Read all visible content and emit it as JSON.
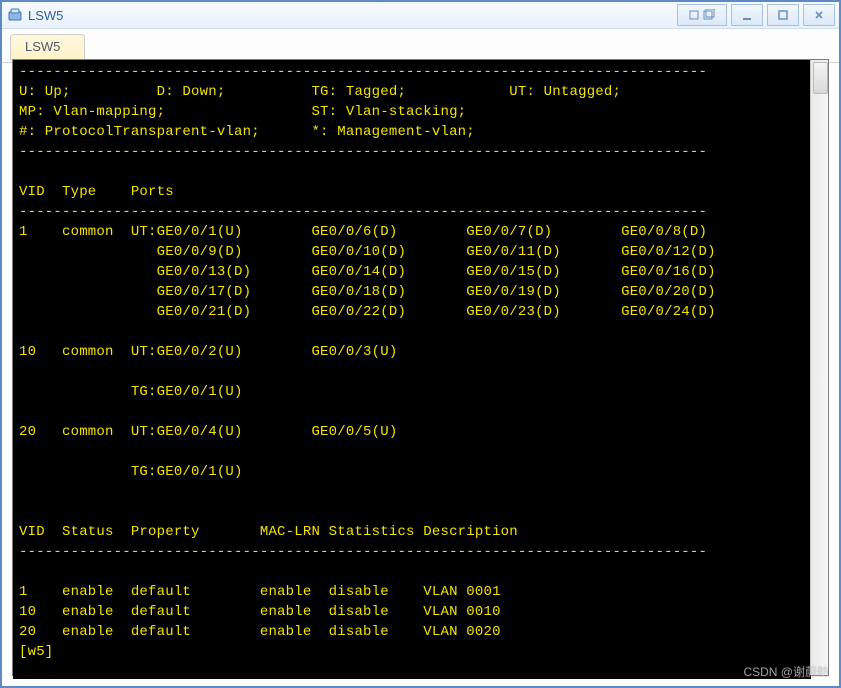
{
  "window": {
    "title": "LSW5"
  },
  "tabs": [
    {
      "label": "LSW5",
      "active": true
    }
  ],
  "legend": {
    "u": "U: Up;",
    "d": "D: Down;",
    "tg": "TG: Tagged;",
    "ut": "UT: Untagged;",
    "mp": "MP: Vlan-mapping;",
    "st": "ST: Vlan-stacking;",
    "hash": "#: ProtocolTransparent-vlan;",
    "star": "*: Management-vlan;"
  },
  "header1": {
    "vid": "VID",
    "type": "Type",
    "ports": "Ports"
  },
  "vlan_ports": [
    {
      "vid": "1",
      "type": "common",
      "tag": "UT:",
      "ports": [
        [
          "GE0/0/1(U)",
          "GE0/0/6(D)",
          "GE0/0/7(D)",
          "GE0/0/8(D)"
        ],
        [
          "GE0/0/9(D)",
          "GE0/0/10(D)",
          "GE0/0/11(D)",
          "GE0/0/12(D)"
        ],
        [
          "GE0/0/13(D)",
          "GE0/0/14(D)",
          "GE0/0/15(D)",
          "GE0/0/16(D)"
        ],
        [
          "GE0/0/17(D)",
          "GE0/0/18(D)",
          "GE0/0/19(D)",
          "GE0/0/20(D)"
        ],
        [
          "GE0/0/21(D)",
          "GE0/0/22(D)",
          "GE0/0/23(D)",
          "GE0/0/24(D)"
        ]
      ]
    },
    {
      "vid": "10",
      "type": "common",
      "tag": "UT:",
      "ports": [
        [
          "GE0/0/2(U)",
          "GE0/0/3(U)"
        ]
      ],
      "tagged": "TG:GE0/0/1(U)"
    },
    {
      "vid": "20",
      "type": "common",
      "tag": "UT:",
      "ports": [
        [
          "GE0/0/4(U)",
          "GE0/0/5(U)"
        ]
      ],
      "tagged": "TG:GE0/0/1(U)"
    }
  ],
  "header2": {
    "vid": "VID",
    "status": "Status",
    "property": "Property",
    "maclrn": "MAC-LRN",
    "stats": "Statistics",
    "desc": "Description"
  },
  "vlan_status": [
    {
      "vid": "1",
      "status": "enable",
      "property": "default",
      "maclrn": "enable",
      "stats": "disable",
      "desc": "VLAN 0001"
    },
    {
      "vid": "10",
      "status": "enable",
      "property": "default",
      "maclrn": "enable",
      "stats": "disable",
      "desc": "VLAN 0010"
    },
    {
      "vid": "20",
      "status": "enable",
      "property": "default",
      "maclrn": "enable",
      "stats": "disable",
      "desc": "VLAN 0020"
    }
  ],
  "prompt": "[w5]",
  "watermark": "CSDN @谢蔚舫"
}
